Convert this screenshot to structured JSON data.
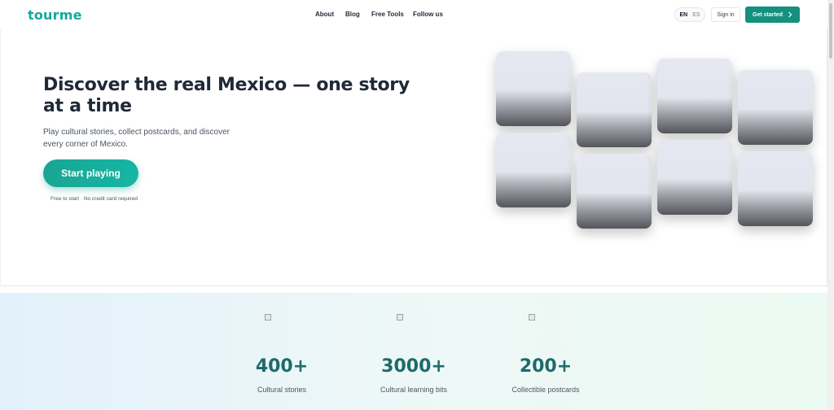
{
  "header": {
    "logo": "tourme",
    "nav": [
      "About",
      "Blog",
      "Free Tools",
      "Follow us"
    ],
    "lang": {
      "en": "EN",
      "es": "ES"
    },
    "signin": "Sign in",
    "get_started": "Get started",
    "get_started_icon": "chevron-right-icon"
  },
  "hero": {
    "title": "Discover the real Mexico — one story at a time",
    "subtitle": "Play cultural stories, collect postcards, and discover every corner of Mexico.",
    "cta": "Start playing",
    "cta_note": "Free to start · No credit card required"
  },
  "stats": [
    {
      "value": "400+",
      "label": "Cultural stories"
    },
    {
      "value": "3000+",
      "label": "Cultural learning bits"
    },
    {
      "value": "200+",
      "label": "Collectible postcards"
    }
  ],
  "colors": {
    "brand": "#14a99a",
    "button": "#15907f",
    "stat_number": "#1d6b6b"
  }
}
